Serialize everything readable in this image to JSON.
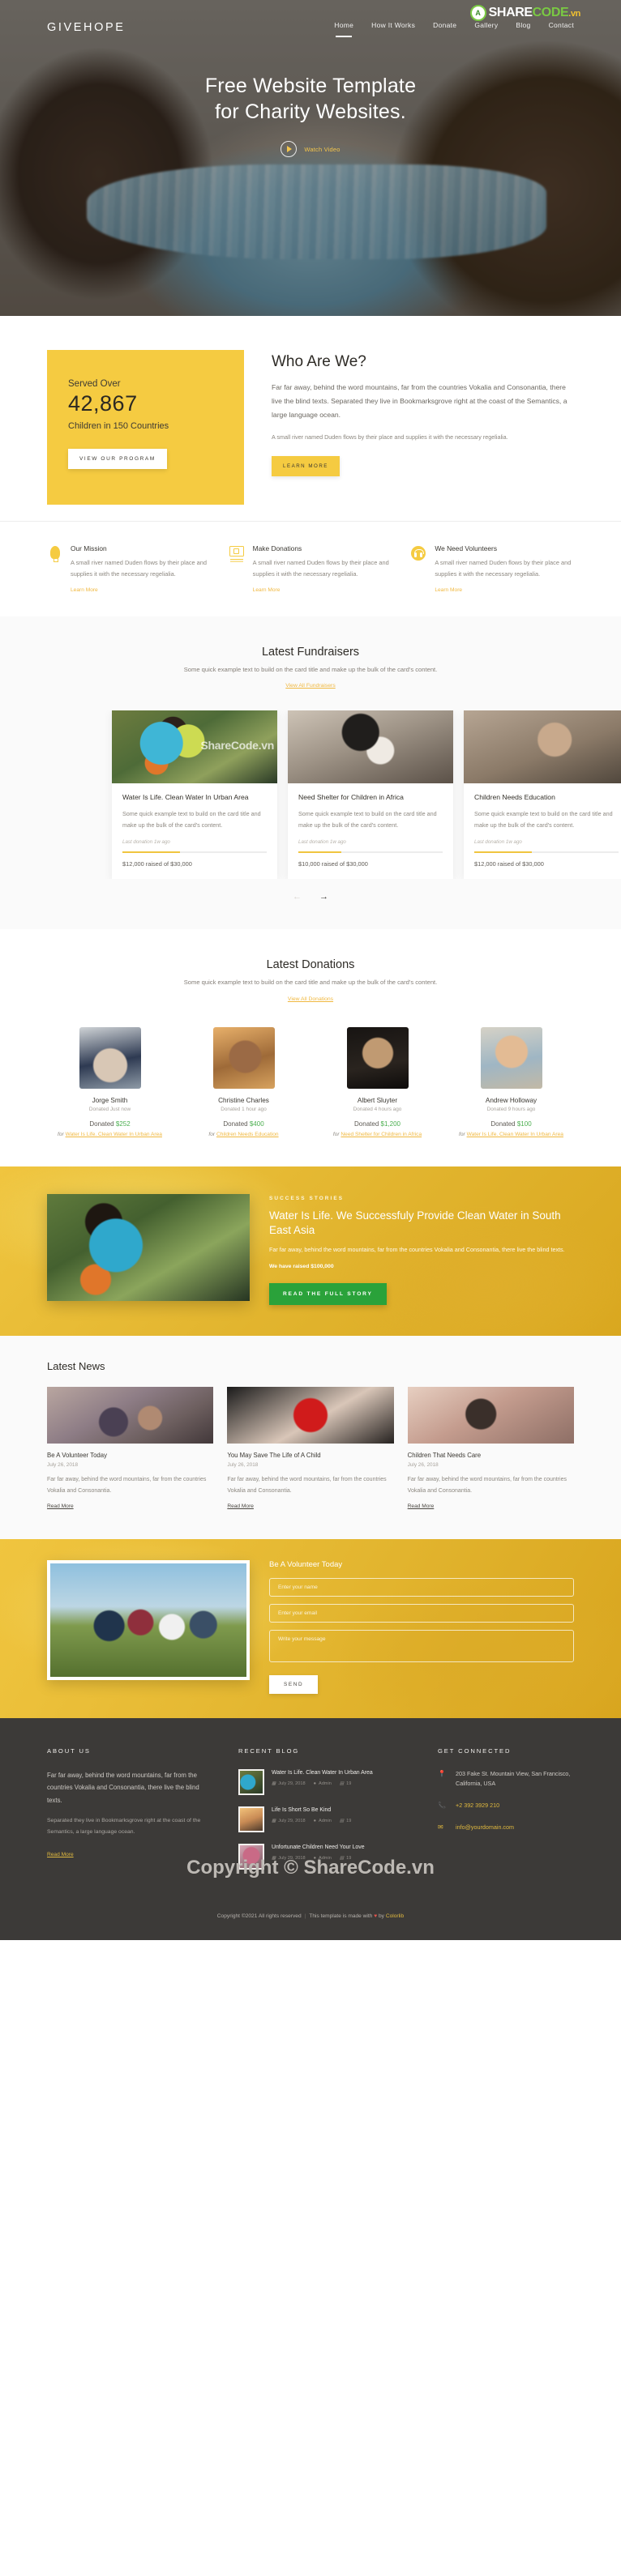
{
  "header": {
    "brand": "GIVEHOPE",
    "nav": [
      {
        "label": "Home",
        "active": true
      },
      {
        "label": "How It Works",
        "active": false
      },
      {
        "label": "Donate",
        "active": false
      },
      {
        "label": "Gallery",
        "active": false
      },
      {
        "label": "Blog",
        "active": false
      },
      {
        "label": "Contact",
        "active": false
      }
    ],
    "watermark": {
      "share": "SHARE",
      "code": "CODE",
      "vn": ".vn",
      "mark": "A"
    }
  },
  "hero": {
    "title_line1": "Free Website Template",
    "title_line2": "for Charity Websites.",
    "watch_label": "Watch Video"
  },
  "about": {
    "stat_label": "Served Over",
    "stat_number": "42,867",
    "stat_sub": "Children in 150 Countries",
    "stat_button": "VIEW OUR PROGRAM",
    "heading": "Who Are We?",
    "paragraph1": "Far far away, behind the word mountains, far from the countries Vokalia and Consonantia, there live the blind texts. Separated they live in Bookmarksgrove right at the coast of the Semantics, a large language ocean.",
    "paragraph2": "A small river named Duden flows by their place and supplies it with the necessary regelialia.",
    "learn_button": "LEARN MORE"
  },
  "features": [
    {
      "icon": "bulb-icon",
      "title": "Our Mission",
      "text": "A small river named Duden flows by their place and supplies it with the necessary regelialia.",
      "link": "Learn More"
    },
    {
      "icon": "money-icon",
      "title": "Make Donations",
      "text": "A small river named Duden flows by their place and supplies it with the necessary regelialia.",
      "link": "Learn More"
    },
    {
      "icon": "volunteer-icon",
      "title": "We Need Volunteers",
      "text": "A small river named Duden flows by their place and supplies it with the necessary regelialia.",
      "link": "Learn More"
    }
  ],
  "fundraisers": {
    "heading": "Latest Fundraisers",
    "subtext": "Some quick example text to build on the card title and make up the bulk of the card's content.",
    "link": "View All Fundraisers",
    "watermark": "ShareCode.vn",
    "cards": [
      {
        "title": "Water Is Life. Clean Water In Urban Area",
        "desc": "Some quick example text to build on the card title and make up the bulk of the card's content.",
        "meta": "Last donation 1w ago",
        "raised": "$12,000 raised of $30,000",
        "progress": 40
      },
      {
        "title": "Need Shelter for Children in Africa",
        "desc": "Some quick example text to build on the card title and make up the bulk of the card's content.",
        "meta": "Last donation 1w ago",
        "raised": "$10,000 raised of $30,000",
        "progress": 30
      },
      {
        "title": "Children Needs Education",
        "desc": "Some quick example text to build on the card title and make up the bulk of the card's content.",
        "meta": "Last donation 1w ago",
        "raised": "$12,000 raised of $30,000",
        "progress": 40
      }
    ],
    "prev_arrow": "←",
    "next_arrow": "→"
  },
  "donations": {
    "heading": "Latest Donations",
    "subtext": "Some quick example text to build on the card title and make up the bulk of the card's content.",
    "link": "View All Donations",
    "items": [
      {
        "name": "Jorge Smith",
        "when": "Donated Just now",
        "amount_label": "Donated",
        "amount": "$252",
        "for_label": "for",
        "cause": "Water Is Life. Clean Water In Urban Area"
      },
      {
        "name": "Christine Charles",
        "when": "Donated 1 hour ago",
        "amount_label": "Donated",
        "amount": "$400",
        "for_label": "for",
        "cause": "Children Needs Education"
      },
      {
        "name": "Albert Sluyter",
        "when": "Donated 4 hours ago",
        "amount_label": "Donated",
        "amount": "$1,200",
        "for_label": "for",
        "cause": "Need Shelter for Children in Africa"
      },
      {
        "name": "Andrew Holloway",
        "when": "Donated 9 hours ago",
        "amount_label": "Donated",
        "amount": "$100",
        "for_label": "for",
        "cause": "Water Is Life. Clean Water In Urban Area"
      }
    ]
  },
  "story": {
    "kicker": "SUCCESS STORIES",
    "heading": "Water Is Life. We Successfuly Provide Clean Water in South East Asia",
    "paragraph": "Far far away, behind the word mountains, far from the countries Vokalia and Consonantia, there live the blind texts.",
    "raised": "We have raised $100,000",
    "button": "READ THE FULL STORY"
  },
  "news": {
    "heading": "Latest News",
    "items": [
      {
        "title": "Be A Volunteer Today",
        "date": "July 26, 2018",
        "text": "Far far away, behind the word mountains, far from the countries Vokalia and Consonantia.",
        "more": "Read More"
      },
      {
        "title": "You May Save The Life of A Child",
        "date": "July 26, 2018",
        "text": "Far far away, behind the word mountains, far from the countries Vokalia and Consonantia.",
        "more": "Read More"
      },
      {
        "title": "Children That Needs Care",
        "date": "July 26, 2018",
        "text": "Far far away, behind the word mountains, far from the countries Vokalia and Consonantia.",
        "more": "Read More"
      }
    ]
  },
  "volunteer": {
    "heading": "Be A Volunteer Today",
    "name_placeholder": "Enter your name",
    "email_placeholder": "Enter your email",
    "message_placeholder": "Write your message",
    "send_button": "SEND"
  },
  "footer": {
    "about_title": "ABOUT US",
    "about_p1": "Far far away, behind the word mountains, far from the countries Vokalia and Consonantia, there live the blind texts.",
    "about_p2": "Separated they live in Bookmarksgrove right at the coast of the Semantics, a large language ocean.",
    "about_read": "Read More",
    "blog_title": "RECENT BLOG",
    "blog": [
      {
        "title": "Water Is Life. Clean Water In Urban Area",
        "date": "July 29, 2018",
        "author": "Admin",
        "comments": "19"
      },
      {
        "title": "Life Is Short So Be Kind",
        "date": "July 29, 2018",
        "author": "Admin",
        "comments": "19"
      },
      {
        "title": "Unfortunate Children Need Your Love",
        "date": "July 29, 2018",
        "author": "Admin",
        "comments": "19"
      }
    ],
    "connect_title": "GET CONNECTED",
    "address": "203 Fake St. Mountain View, San Francisco, California, USA",
    "phone": "+2 392 3929 210",
    "email": "info@yourdomain.com",
    "watermark": "Copyright © ShareCode.vn",
    "copyright": "Copyright ©2021 All rights reserved",
    "made_with": "This template is made with",
    "heart": "♥",
    "by": "by",
    "brand": "Colorlib"
  }
}
